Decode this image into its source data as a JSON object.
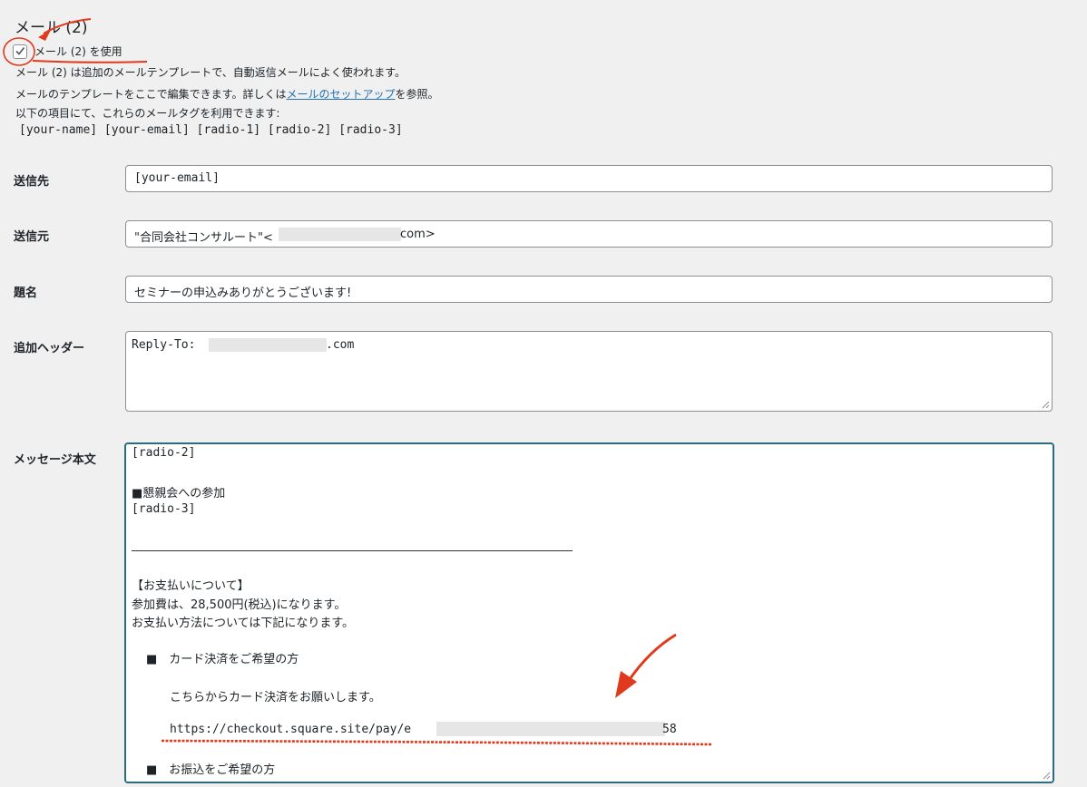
{
  "section": {
    "title": "メール (2)",
    "use_label": "メール (2) を使用",
    "checked": true
  },
  "description": {
    "line1": "メール (2) は追加のメールテンプレートで、自動返信メールによく使われます。",
    "line2_prefix": "メールのテンプレートをここで編集できます。詳しくは",
    "line2_link": "メールのセットアップ",
    "line2_suffix": "を参照。",
    "line3": "以下の項目にて、これらのメールタグを利用できます:",
    "tags": "[your-name] [your-email] [radio-1] [radio-2] [radio-3]"
  },
  "fields": {
    "to": {
      "label": "送信先",
      "value": "[your-email]"
    },
    "from": {
      "label": "送信元",
      "value_prefix": "\"合同会社コンサルート\"<",
      "value_suffix": "com>"
    },
    "subject": {
      "label": "題名",
      "value": "セミナーの申込みありがとうございます!"
    },
    "headers": {
      "label": "追加ヘッダー",
      "value_prefix": "Reply-To: ",
      "value_suffix": ".com"
    },
    "body": {
      "label": "メッセージ本文",
      "lines": {
        "l1": "[radio-2]",
        "l2": "■懇親会への参加",
        "l3": "[radio-3]",
        "l4": "【お支払いについて】",
        "l5": "参加費は、28,500円(税込)になります。",
        "l6": "お支払い方法については下記になります。",
        "l7": "■　カード決済をご希望の方",
        "l8": "こちらからカード決済をお願いします。",
        "l9_prefix": "https://checkout.square.site/pay/e",
        "l9_suffix": "58",
        "l10": "■　お振込をご希望の方"
      }
    }
  },
  "colors": {
    "annotation": "#e03a1e",
    "link": "#2271b1",
    "focus_border": "#2c6c7f"
  }
}
